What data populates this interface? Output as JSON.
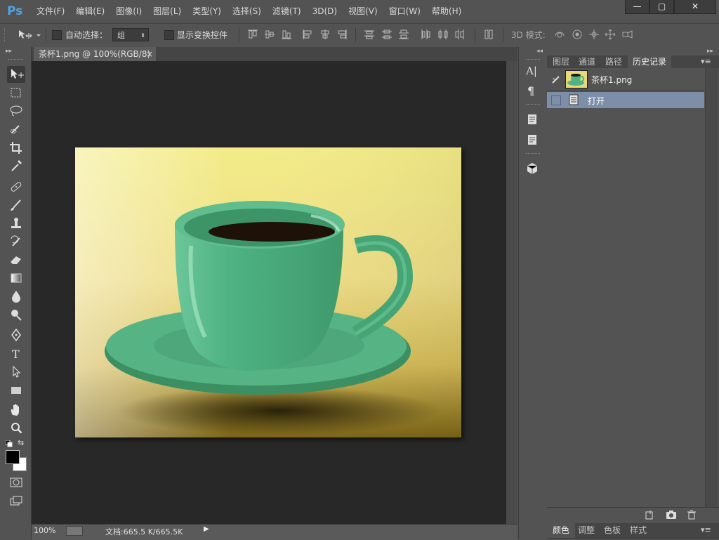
{
  "app": {
    "logo": "Ps"
  },
  "menu": [
    "文件(F)",
    "编辑(E)",
    "图像(I)",
    "图层(L)",
    "类型(Y)",
    "选择(S)",
    "滤镜(T)",
    "3D(D)",
    "视图(V)",
    "窗口(W)",
    "帮助(H)"
  ],
  "window_controls": {
    "minimize": "—",
    "maximize": "▢",
    "close": "✕"
  },
  "options_bar": {
    "auto_select_label": "自动选择：",
    "auto_select_checked": false,
    "auto_select_value": "组",
    "show_transform_label": "显示变换控件",
    "show_transform_checked": false,
    "mode_3d_label": "3D 模式:"
  },
  "document": {
    "tab_title": "茶杯1.png @ 100%(RGB/8)",
    "tab_close": "×",
    "zoom": "100%",
    "doc_info": "文档:665.5 K/665.5K"
  },
  "tools": [
    "move-tool",
    "marquee-tool",
    "lasso-tool",
    "quick-selection-tool",
    "crop-tool",
    "eyedropper-tool",
    "healing-brush-tool",
    "brush-tool",
    "clone-stamp-tool",
    "history-brush-tool",
    "eraser-tool",
    "gradient-tool",
    "blur-tool",
    "dodge-tool",
    "pen-tool",
    "type-tool",
    "path-selection-tool",
    "rectangle-tool",
    "hand-tool",
    "zoom-tool"
  ],
  "colors": {
    "foreground": "#000000",
    "background": "#ffffff",
    "selection": "#7d8fa8",
    "logo": "#4fa2e3"
  },
  "panel": {
    "tabs": [
      "图层",
      "通道",
      "路径",
      "历史记录"
    ],
    "active_tab": "历史记录",
    "snapshot_name": "茶杯1.png",
    "history_items": [
      {
        "label": "打开",
        "selected": true
      }
    ]
  },
  "bottom_tabs": [
    "颜色",
    "调整",
    "色板",
    "样式"
  ],
  "bottom_active_tab": "颜色"
}
